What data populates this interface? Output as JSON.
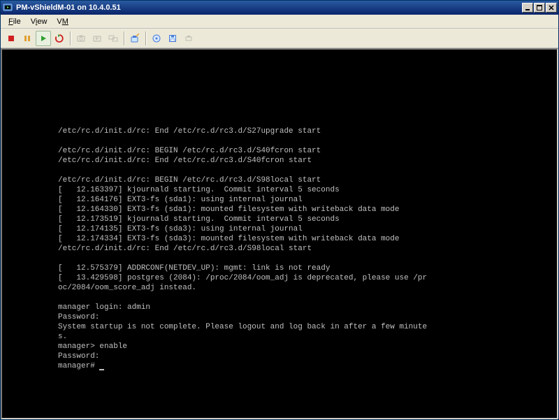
{
  "window": {
    "title": "PM-vShieldM-01 on 10.4.0.51"
  },
  "menubar": {
    "items": [
      {
        "label": "File",
        "accel": "F"
      },
      {
        "label": "View",
        "accel": "V"
      },
      {
        "label": "VM",
        "accel": "M"
      }
    ]
  },
  "toolbar": {
    "stop_icon": "stop",
    "pause_icon": "pause",
    "play_icon": "play",
    "reset_icon": "reset",
    "snapshot_icon": "snapshot",
    "revert_icon": "revert",
    "manage_snap_icon": "manage-snapshots",
    "settings_icon": "settings",
    "connect_cd_icon": "connect-cd",
    "connect_floppy_icon": "connect-floppy",
    "connect_net_icon": "connect-network"
  },
  "console": {
    "lines": [
      "/etc/rc.d/init.d/rc: End /etc/rc.d/rc3.d/S27upgrade start",
      "",
      "/etc/rc.d/init.d/rc: BEGIN /etc/rc.d/rc3.d/S40fcron start",
      "/etc/rc.d/init.d/rc: End /etc/rc.d/rc3.d/S40fcron start",
      "",
      "/etc/rc.d/init.d/rc: BEGIN /etc/rc.d/rc3.d/S98local start",
      "[   12.163397] kjournald starting.  Commit interval 5 seconds",
      "[   12.164176] EXT3-fs (sda1): using internal journal",
      "[   12.164330] EXT3-fs (sda1): mounted filesystem with writeback data mode",
      "[   12.173519] kjournald starting.  Commit interval 5 seconds",
      "[   12.174135] EXT3-fs (sda3): using internal journal",
      "[   12.174334] EXT3-fs (sda3): mounted filesystem with writeback data mode",
      "/etc/rc.d/init.d/rc: End /etc/rc.d/rc3.d/S98local start",
      "",
      "[   12.575379] ADDRCONF(NETDEV_UP): mgmt: link is not ready",
      "[   13.429598] postgres (2084): /proc/2084/oom_adj is deprecated, please use /pr",
      "oc/2084/oom_score_adj instead.",
      "",
      "manager login: admin",
      "Password:",
      "System startup is not complete. Please logout and log back in after a few minute",
      "s.",
      "manager> enable",
      "Password:",
      "manager# "
    ],
    "login_value": "admin",
    "prompt_after_login": "manager>",
    "enable_cmd": "enable",
    "root_prompt": "manager#"
  }
}
